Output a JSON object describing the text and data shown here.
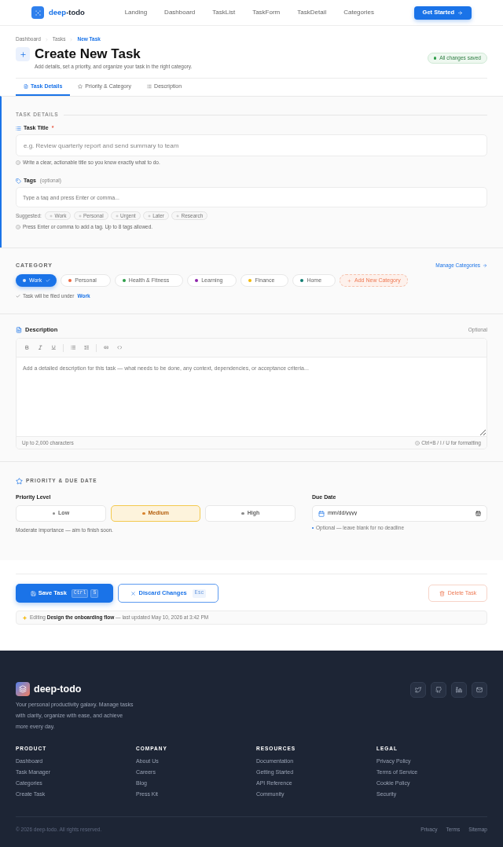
{
  "nav": {
    "logo": {
      "accent": "deep",
      "rest": "-todo"
    },
    "links": [
      "Landing",
      "Dashboard",
      "TaskList",
      "TaskForm",
      "TaskDetail",
      "Categories"
    ],
    "cta": "Get Started"
  },
  "breadcrumb": [
    {
      "label": "Dashboard",
      "current": false
    },
    {
      "label": "Tasks",
      "current": false
    },
    {
      "label": "New Task",
      "current": true
    }
  ],
  "header": {
    "title": "Create New Task",
    "subtitle": "Add details, set a priority, and organize your task in the right category.",
    "status": "All changes saved"
  },
  "tabs": [
    {
      "label": "Task Details",
      "selected": true
    },
    {
      "label": "Priority & Category",
      "selected": false
    },
    {
      "label": "Description",
      "selected": false
    }
  ],
  "task_details": {
    "heading": "TASK DETAILS",
    "title_field": {
      "label": "Task Title",
      "required_mark": "*",
      "placeholder": "e.g. Review quarterly report and send summary to team",
      "hint": "Write a clear, actionable title so you know exactly what to do."
    },
    "tags_field": {
      "label": "Tags",
      "note": "(optional)",
      "placeholder": "Type a tag and press Enter or comma...",
      "suggested_label": "Suggested:",
      "suggestions": [
        "Work",
        "Personal",
        "Urgent",
        "Later",
        "Research"
      ],
      "hint": "Press Enter or comma to add a tag. Up to 8 tags allowed."
    }
  },
  "category": {
    "heading": "CATEGORY",
    "manage_link": "Manage Categories",
    "options": [
      {
        "label": "Work",
        "color": "#1a73e8",
        "selected": true
      },
      {
        "label": "Personal",
        "color": "#f0673e",
        "selected": false
      },
      {
        "label": "Health & Fitness",
        "color": "#2e9e48",
        "selected": false
      },
      {
        "label": "Learning",
        "color": "#8e24aa",
        "selected": false
      },
      {
        "label": "Finance",
        "color": "#f5b800",
        "selected": false
      },
      {
        "label": "Home",
        "color": "#0f7c72",
        "selected": false
      }
    ],
    "add_label": "Add New Category",
    "filed_note": {
      "text": "Task will be filed under",
      "value": "Work"
    }
  },
  "description": {
    "heading": "Description",
    "optional": "Optional",
    "placeholder": "Add a detailed description for this task — what needs to be done, any context, dependencies, or acceptance criteria...",
    "char_limit": "Up to 2,000 characters",
    "format_hint": "Ctrl+B / I / U for formatting"
  },
  "priority": {
    "heading": "PRIORITY & DUE DATE",
    "level_label": "Priority Level",
    "levels": [
      {
        "label": "Low",
        "selected": false
      },
      {
        "label": "Medium",
        "selected": true
      },
      {
        "label": "High",
        "selected": false
      }
    ],
    "level_hint": "Moderate importance — aim to finish soon.",
    "due_label": "Due Date",
    "due_placeholder": "mm/dd/yyyy",
    "due_hint": "Optional — leave blank for no deadline"
  },
  "actions": {
    "save": {
      "label": "Save Task",
      "keys": [
        "Ctrl",
        "S"
      ]
    },
    "discard": {
      "label": "Discard Changes",
      "keys": [
        "Esc"
      ]
    },
    "delete": "Delete Task",
    "editing_note": "Editing **Design the onboarding flow** — last updated May 10, 2026 at 3:42 PM"
  },
  "footer": {
    "brand": "deep-todo",
    "tagline": "Your personal productivity galaxy. Manage tasks with clarity, organize with ease, and achieve more every day.",
    "columns": [
      {
        "title": "PRODUCT",
        "links": [
          "Dashboard",
          "Task Manager",
          "Categories",
          "Create Task"
        ]
      },
      {
        "title": "COMPANY",
        "links": [
          "About Us",
          "Careers",
          "Blog",
          "Press Kit"
        ]
      },
      {
        "title": "RESOURCES",
        "links": [
          "Documentation",
          "Getting Started",
          "API Reference",
          "Community"
        ]
      },
      {
        "title": "LEGAL",
        "links": [
          "Privacy Policy",
          "Terms of Service",
          "Cookie Policy",
          "Security"
        ]
      }
    ],
    "copyright": "© 2026 deep-todo. All rights reserved.",
    "bottom_links": [
      "Privacy",
      "Terms",
      "Sitemap"
    ]
  }
}
